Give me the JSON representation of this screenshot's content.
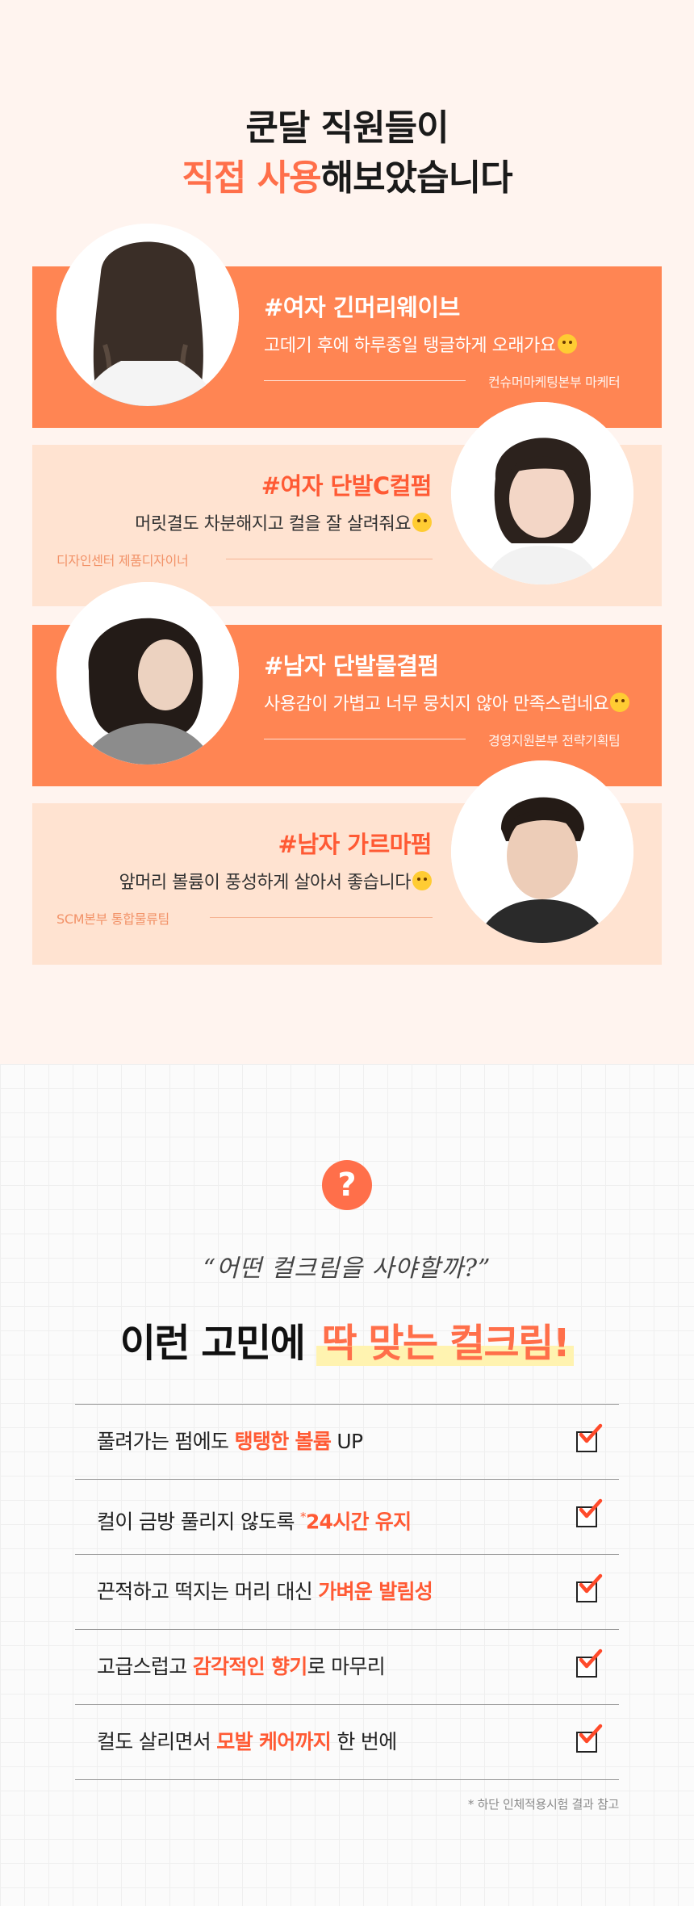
{
  "header": {
    "line1": "쿤달 직원들이",
    "line2_accent": "직접 사용",
    "line2_rest": "해보았습니다"
  },
  "reviews": [
    {
      "tag": "#여자 긴머리웨이브",
      "quote": "고데기 후에 하루종일 탱글하게 오래가요",
      "role": "컨슈머마케팅본부 마케터"
    },
    {
      "tag": "#여자 단발C컬펌",
      "quote": "머릿결도 차분해지고 컬을 잘 살려줘요",
      "role": "디자인센터 제품디자이너"
    },
    {
      "tag": "#남자 단발물결펌",
      "quote": "사용감이 가볍고 너무 뭉치지 않아 만족스럽네요",
      "role": "경영지원본부 전략기획팀"
    },
    {
      "tag": "#남자 가르마펌",
      "quote": "앞머리 볼륨이 풍성하게 살아서 좋습니다",
      "role": "SCM본부 통합물류팀"
    }
  ],
  "section2": {
    "question_icon": "?",
    "handwritten": "“어떤 컬크림을 사야할까?”",
    "headline_prefix": "이런 고민에 ",
    "headline_highlight": "딱 맞는 컬크림!",
    "checklist": [
      {
        "before": "풀려가는 펌에도 ",
        "em": "탱탱한 볼륨",
        "after": " UP"
      },
      {
        "before": "컬이 금방 풀리지 않도록 ",
        "sup": "*",
        "em": "24시간 유지",
        "after": ""
      },
      {
        "before": "끈적하고 떡지는 머리 대신 ",
        "em": "가벼운 발림성",
        "after": ""
      },
      {
        "before": "고급스럽고 ",
        "em": "감각적인 향기",
        "after": "로 마무리"
      },
      {
        "before": "컬도 살리면서 ",
        "em": "모발 케어까지",
        "after": " 한 번에"
      }
    ],
    "footnote": "* 하단 인체적용시험 결과 참고"
  },
  "colors": {
    "accent": "#ff6f4a",
    "card_dark": "#ff8553",
    "card_light": "#ffe3d1",
    "section_bg": "#fff4ef"
  }
}
